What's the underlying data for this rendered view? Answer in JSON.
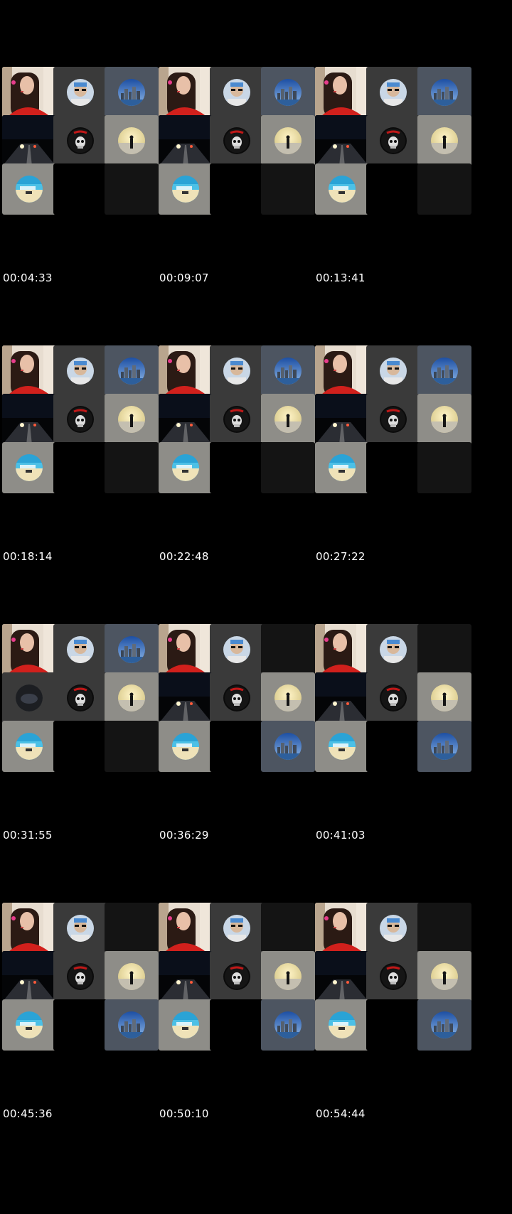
{
  "grid": {
    "frames": [
      {
        "timestamp": "00:04:33",
        "row2_right": "light",
        "row3_right": "dark",
        "top_right": "slate"
      },
      {
        "timestamp": "00:09:07",
        "row2_right": "light",
        "row3_right": "dark",
        "top_right": "slate"
      },
      {
        "timestamp": "00:13:41",
        "row2_right": "light",
        "row3_right": "dark",
        "top_right": "slate"
      },
      {
        "timestamp": "00:18:14",
        "row2_right": "light",
        "row3_right": "dark",
        "top_right": "slate"
      },
      {
        "timestamp": "00:22:48",
        "row2_right": "light",
        "row3_right": "dark",
        "top_right": "slate"
      },
      {
        "timestamp": "00:27:22",
        "row2_right": "light",
        "row3_right": "dark",
        "top_right": "slate"
      },
      {
        "timestamp": "00:31:55",
        "row2_right": "light",
        "row3_right": "dark",
        "top_right": "slate"
      },
      {
        "timestamp": "00:36:29",
        "row2_right": "light",
        "row3_right": "city",
        "top_right": "dark"
      },
      {
        "timestamp": "00:41:03",
        "row2_right": "light",
        "row3_right": "city",
        "top_right": "dark"
      },
      {
        "timestamp": "00:45:36",
        "row2_right": "light",
        "row3_right": "city",
        "top_right": "dark"
      },
      {
        "timestamp": "00:50:10",
        "row2_right": "light",
        "row3_right": "city",
        "top_right": "dark"
      },
      {
        "timestamp": "00:54:44",
        "row2_right": "light",
        "row3_right": "city",
        "top_right": "dark"
      }
    ]
  },
  "icons": {
    "person_video": "person-video-thumbnail",
    "avatar_face": "face-avatar-icon",
    "avatar_city": "city-avatar-icon",
    "road_video": "night-road-thumbnail",
    "avatar_skull": "skull-avatar-icon",
    "avatar_moon": "moon-silhouette-avatar-icon",
    "avatar_beach": "beach-avatar-icon"
  }
}
